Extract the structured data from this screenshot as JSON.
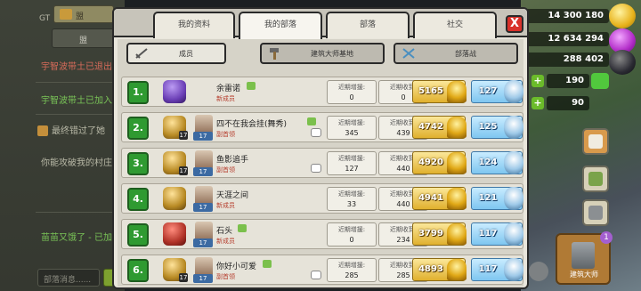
{
  "chat": {
    "top_label": "GT",
    "top_button_label": "盟",
    "tab_label": "盟",
    "messages": [
      {
        "text": "宇智波带土已退出部落",
        "color": "red"
      },
      {
        "text": "宇智波带土已加入部落",
        "color": "green"
      },
      {
        "text": "最终错过了她",
        "color": "grey"
      },
      {
        "text": "你能攻破我的村庄吗",
        "color": "grey"
      },
      {
        "text": "苗苗又饿了 - 已加入",
        "color": "green"
      }
    ],
    "input_placeholder": "部落消息......",
    "send_label": ""
  },
  "resources": {
    "gold": "14 300 180",
    "elixir": "12 634 294",
    "dark_elixir": "288 402",
    "gems": "190",
    "builder_gems": "90"
  },
  "builder": {
    "label": "建筑大师",
    "badge": "1"
  },
  "tabs": [
    {
      "label": "我的资料"
    },
    {
      "label": "我的部落"
    },
    {
      "label": "部落"
    },
    {
      "label": "社交"
    }
  ],
  "close_label": "X",
  "subtabs": [
    {
      "label": "成员",
      "icon": "sword-icon"
    },
    {
      "label": "建筑大师基地",
      "icon": "hammer-icon"
    },
    {
      "label": "部落战",
      "icon": "crossed-swords-icon"
    }
  ],
  "stat_labels": {
    "received": "近期增援:",
    "donated": "近期收到:"
  },
  "members": [
    {
      "rank": "1.",
      "name": "余雷诺",
      "role": "新成员",
      "league": "purple",
      "th": "",
      "bh": "",
      "received": "0",
      "donated": "0",
      "trophies": "5165",
      "vs": "127"
    },
    {
      "rank": "2.",
      "name": "四不在我会挂(舞秀)",
      "role": "副首领",
      "league": "titan",
      "th": "17",
      "bh": "17",
      "received": "345",
      "donated": "439",
      "trophies": "4742",
      "vs": "125"
    },
    {
      "rank": "3.",
      "name": "鱼影追手",
      "role": "副首领",
      "league": "titan",
      "th": "17",
      "bh": "17",
      "received": "127",
      "donated": "440",
      "trophies": "4920",
      "vs": "124"
    },
    {
      "rank": "4.",
      "name": "天涯之间",
      "role": "新成员",
      "league": "titan",
      "th": "",
      "bh": "17",
      "received": "33",
      "donated": "440",
      "trophies": "4941",
      "vs": "121"
    },
    {
      "rank": "5.",
      "name": "石头",
      "role": "新成员",
      "league": "red",
      "th": "",
      "bh": "17",
      "received": "0",
      "donated": "234",
      "trophies": "3799",
      "vs": "117"
    },
    {
      "rank": "6.",
      "name": "你好小可爱",
      "role": "副首领",
      "league": "titan",
      "th": "17",
      "bh": "17",
      "received": "285",
      "donated": "285",
      "trophies": "4893",
      "vs": "117"
    }
  ]
}
